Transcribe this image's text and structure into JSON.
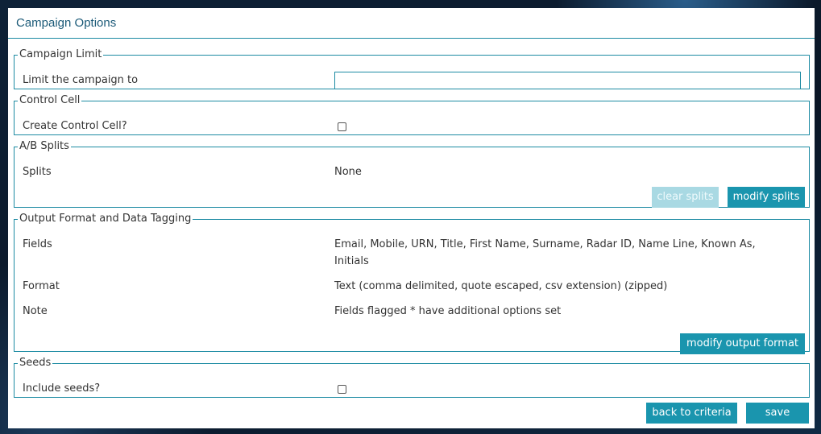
{
  "panel": {
    "title": "Campaign Options"
  },
  "sections": {
    "campaign_limit": {
      "legend": "Campaign Limit",
      "label": "Limit the campaign to",
      "value": "",
      "placeholder": ""
    },
    "control_cell": {
      "legend": "Control Cell",
      "label": "Create Control Cell?",
      "checked": false
    },
    "ab_splits": {
      "legend": "A/B Splits",
      "label": "Splits",
      "value": "None",
      "clear_button": "clear splits",
      "modify_button": "modify splits"
    },
    "output_format": {
      "legend": "Output Format and Data Tagging",
      "fields_label": "Fields",
      "fields_value": "Email, Mobile, URN, Title, First Name, Surname, Radar ID, Name Line, Known As, Initials",
      "format_label": "Format",
      "format_value": "Text (comma delimited, quote escaped, csv extension) (zipped)",
      "note_label": "Note",
      "note_value": "Fields flagged * have additional options set",
      "modify_button": "modify output format"
    },
    "seeds": {
      "legend": "Seeds",
      "label": "Include seeds?",
      "checked": false
    }
  },
  "footer": {
    "back_button": "back to criteria",
    "save_button": "save"
  },
  "colors": {
    "accent": "#1a95ae",
    "border": "#1d8ba3",
    "title": "#1b5a78",
    "disabled_button": "#a9d9e3"
  }
}
